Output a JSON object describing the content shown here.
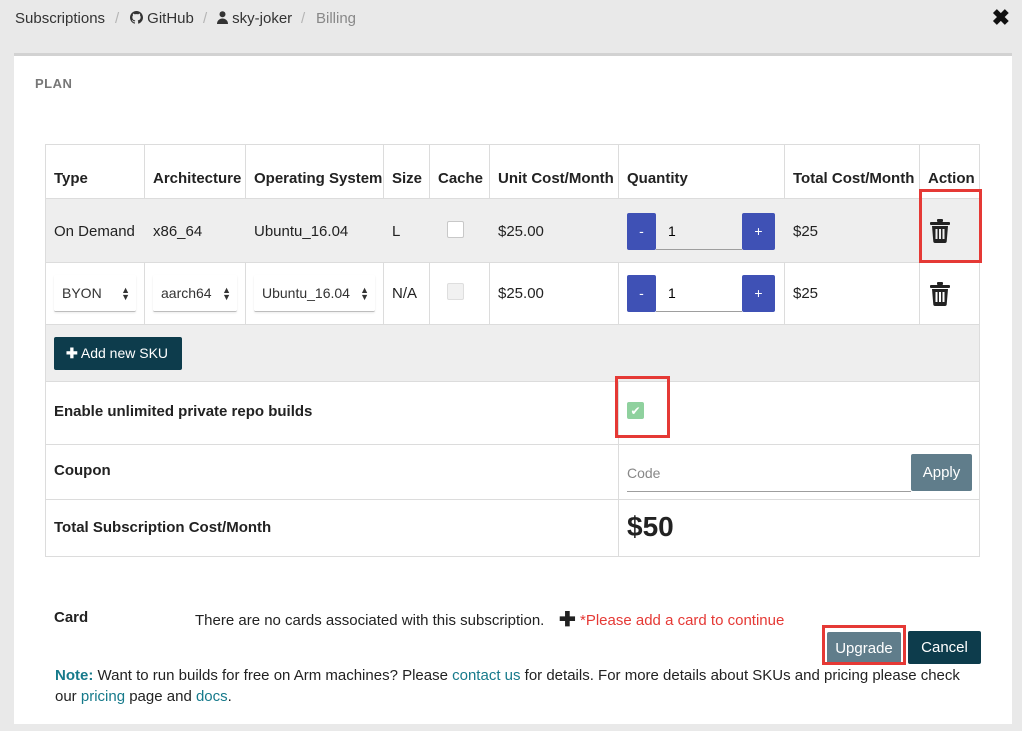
{
  "breadcrumb": {
    "items": [
      "Subscriptions",
      "GitHub",
      "sky-joker",
      "Billing"
    ],
    "separator": "/"
  },
  "close_icon": "close-icon",
  "plan": {
    "label": "PLAN",
    "headers": [
      "Type",
      "Architecture",
      "Operating System",
      "Size",
      "Cache",
      "Unit Cost/Month",
      "Quantity",
      "Total Cost/Month",
      "Action"
    ],
    "rows": [
      {
        "type": "On Demand",
        "arch": "x86_64",
        "os": "Ubuntu_16.04",
        "size": "L",
        "cache_checked": false,
        "unit_cost": "$25.00",
        "qty_minus": "-",
        "qty": "1",
        "qty_plus": "+",
        "total": "$25"
      },
      {
        "type": "BYON",
        "arch": "aarch64",
        "os": "Ubuntu_16.04",
        "size": "N/A",
        "cache_checked": false,
        "unit_cost": "$25.00",
        "qty_minus": "-",
        "qty": "1",
        "qty_plus": "+",
        "total": "$25"
      }
    ],
    "add_sku_label": "Add new SKU",
    "unlimited_label": "Enable unlimited private repo builds",
    "unlimited_checked": true,
    "coupon_label": "Coupon",
    "coupon_placeholder": "Code",
    "apply_label": "Apply",
    "total_label": "Total Subscription Cost/Month",
    "total_value": "$50"
  },
  "card": {
    "label": "Card",
    "message": "There are no cards associated with this subscription.",
    "warning": "*Please add a card to continue"
  },
  "buttons": {
    "upgrade": "Upgrade",
    "cancel": "Cancel"
  },
  "note": {
    "prefix": "Note:",
    "text1": "Want to run builds for free on Arm machines? Please",
    "link_contact": "contact us",
    "text2": "for details. For more details about SKUs and pricing please check our",
    "link_pricing": "pricing",
    "text3": "page and",
    "link_docs": "docs",
    "text4": "."
  },
  "colors": {
    "accent_blue": "#3f51b5",
    "dark_teal": "#0d3c4c",
    "slate": "#607d8b",
    "highlight": "#e53935",
    "link": "#167a8b"
  }
}
